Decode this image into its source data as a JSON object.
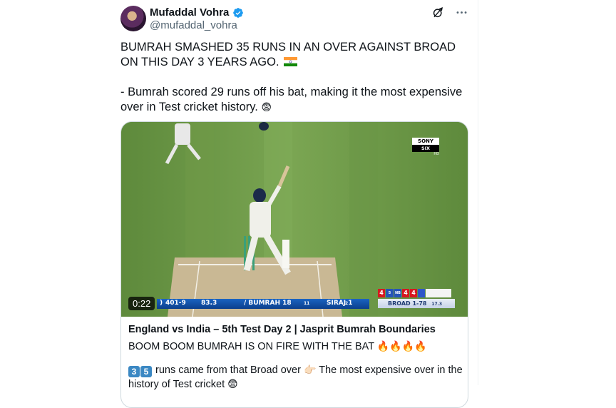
{
  "author": {
    "name": "Mufaddal Vohra",
    "handle": "@mufaddal_vohra",
    "verified_color": "#1d9bf0"
  },
  "icons": [
    "grok-icon",
    "more-icon",
    "verified-badge-icon",
    "india-flag-icon",
    "shocked-face-icon",
    "fire-icon",
    "backhand-index-icon"
  ],
  "tweet": {
    "line1": "BUMRAH SMASHED 35 RUNS IN AN OVER AGAINST BROAD ON THIS DAY 3 YEARS AGO.",
    "line2": "- Bumrah scored 29 runs off his bat, making it the most expensive over in Test cricket history."
  },
  "video": {
    "duration": "0:22",
    "broadcaster_top": "SONY",
    "broadcaster_bottom": "SIX",
    "broadcaster_hd": "HD",
    "score_left": ")",
    "score": "401-9",
    "overs": "83.3",
    "batter1": "/ BUMRAH 18",
    "batter1_balls": "11",
    "batter2": "SIRAJ 1",
    "batter2_balls": "2",
    "balls": [
      "4",
      "5 WD",
      "NB",
      "4",
      "4"
    ],
    "bowler": "BROAD 1-78",
    "bowler_overs": "17.3"
  },
  "card": {
    "title": "England vs India – 5th Test Day 2 | Jasprit Bumrah Boundaries",
    "desc": "BOOM BOOM BUMRAH IS ON FIRE WITH THE BAT",
    "desc2_key1": "3",
    "desc2_key2": "5",
    "desc2_part1": "runs came from that Broad over",
    "desc2_part2": "The most expensive over in the history of Test cricket"
  }
}
